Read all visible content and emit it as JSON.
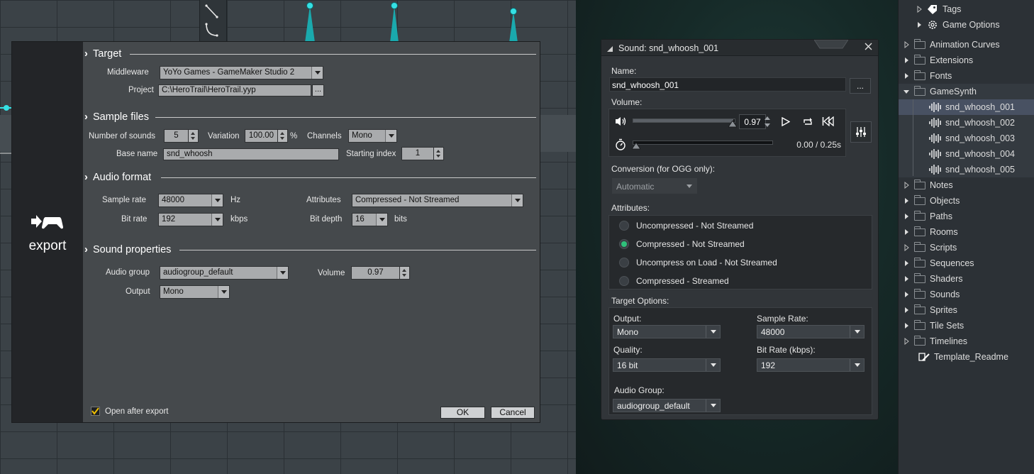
{
  "synth_background": {
    "spike_color": "#27c4c4"
  },
  "asset_tree": {
    "items": [
      {
        "label": "Tags",
        "kind": "tag"
      },
      {
        "label": "Game Options",
        "kind": "gear"
      },
      {
        "label": "Animation Curves",
        "kind": "folder"
      },
      {
        "label": "Extensions",
        "kind": "folder"
      },
      {
        "label": "Fonts",
        "kind": "folder"
      },
      {
        "label": "GameSynth",
        "kind": "folder-open"
      },
      {
        "label": "snd_whoosh_001",
        "kind": "sound",
        "selected": true
      },
      {
        "label": "snd_whoosh_002",
        "kind": "sound"
      },
      {
        "label": "snd_whoosh_003",
        "kind": "sound"
      },
      {
        "label": "snd_whoosh_004",
        "kind": "sound"
      },
      {
        "label": "snd_whoosh_005",
        "kind": "sound"
      },
      {
        "label": "Notes",
        "kind": "folder"
      },
      {
        "label": "Objects",
        "kind": "folder"
      },
      {
        "label": "Paths",
        "kind": "folder"
      },
      {
        "label": "Rooms",
        "kind": "folder"
      },
      {
        "label": "Scripts",
        "kind": "folder"
      },
      {
        "label": "Sequences",
        "kind": "folder"
      },
      {
        "label": "Shaders",
        "kind": "folder"
      },
      {
        "label": "Sounds",
        "kind": "folder"
      },
      {
        "label": "Sprites",
        "kind": "folder"
      },
      {
        "label": "Tile Sets",
        "kind": "folder"
      },
      {
        "label": "Timelines",
        "kind": "folder"
      },
      {
        "label": "Template_Readme",
        "kind": "note"
      }
    ]
  },
  "export_dialog": {
    "brand_label": "export",
    "target": {
      "heading": "Target",
      "middleware_label": "Middleware",
      "middleware_value": "YoYo Games - GameMaker Studio 2",
      "project_label": "Project",
      "project_value": "C:\\HeroTrail\\HeroTrail.yyp",
      "browse_label": "..."
    },
    "sample_files": {
      "heading": "Sample files",
      "num_sounds_label": "Number of sounds",
      "num_sounds_value": "5",
      "variation_label": "Variation",
      "variation_value": "100.00",
      "variation_unit": "%",
      "channels_label": "Channels",
      "channels_value": "Mono",
      "base_name_label": "Base name",
      "base_name_value": "snd_whoosh",
      "starting_index_label": "Starting index",
      "starting_index_value": "1"
    },
    "audio_format": {
      "heading": "Audio format",
      "sample_rate_label": "Sample rate",
      "sample_rate_value": "48000",
      "sample_rate_unit": "Hz",
      "attributes_label": "Attributes",
      "attributes_value": "Compressed - Not Streamed",
      "bit_rate_label": "Bit rate",
      "bit_rate_value": "192",
      "bit_rate_unit": "kbps",
      "bit_depth_label": "Bit depth",
      "bit_depth_value": "16",
      "bit_depth_unit": "bits"
    },
    "sound_properties": {
      "heading": "Sound properties",
      "audio_group_label": "Audio group",
      "audio_group_value": "audiogroup_default",
      "volume_label": "Volume",
      "volume_value": "0.97",
      "output_label": "Output",
      "output_value": "Mono"
    },
    "open_after_export_label": "Open after export",
    "open_after_export_checked": true,
    "ok_label": "OK",
    "cancel_label": "Cancel"
  },
  "sound_editor": {
    "title": "Sound: snd_whoosh_001",
    "name_label": "Name:",
    "name_value": "snd_whoosh_001",
    "browse_label": "...",
    "volume_label": "Volume:",
    "volume_value": "0.97",
    "volume_level": 0.97,
    "playback_position": 0.0,
    "time_display": "0.00 / 0.25s",
    "conversion_label": "Conversion (for OGG only):",
    "conversion_value": "Automatic",
    "attributes_label": "Attributes:",
    "attributes_options": [
      {
        "label": "Uncompressed - Not Streamed",
        "selected": false
      },
      {
        "label": "Compressed - Not Streamed",
        "selected": true
      },
      {
        "label": "Uncompress on Load - Not Streamed",
        "selected": false
      },
      {
        "label": "Compressed - Streamed",
        "selected": false
      }
    ],
    "target_options_label": "Target Options:",
    "output_label": "Output:",
    "output_value": "Mono",
    "sample_rate_label": "Sample Rate:",
    "sample_rate_value": "48000",
    "quality_label": "Quality:",
    "quality_value": "16 bit",
    "bit_rate_label": "Bit Rate (kbps):",
    "bit_rate_value": "192",
    "audio_group_label": "Audio Group:",
    "audio_group_value": "audiogroup_default",
    "accent_color": "#2ec07a"
  }
}
